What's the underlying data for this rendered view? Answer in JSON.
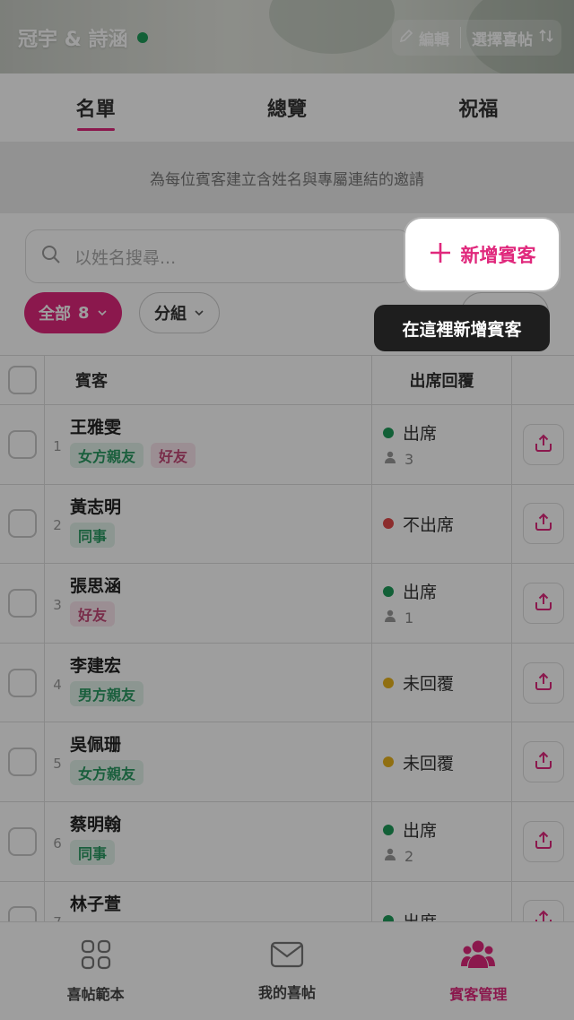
{
  "header": {
    "couple_name": "冠宇 & 詩涵",
    "edit_label": "編輯",
    "select_invite_label": "選擇喜帖"
  },
  "tabs": [
    {
      "label": "名單",
      "active": true
    },
    {
      "label": "總覽",
      "active": false
    },
    {
      "label": "祝福",
      "active": false
    }
  ],
  "info_text": "為每位賓客建立含姓名與專屬連結的邀請",
  "search": {
    "placeholder": "以姓名搜尋..."
  },
  "add_guest_label": "新增賓客",
  "tooltip_text": "在這裡新增賓客",
  "filters": {
    "all_label": "全部",
    "all_count": "8",
    "group_label": "分組"
  },
  "table": {
    "col_guest": "賓客",
    "col_rsvp": "出席回覆",
    "rows": [
      {
        "num": "1",
        "name": "王雅雯",
        "tags": [
          {
            "text": "女方親友",
            "color": "green"
          },
          {
            "text": "好友",
            "color": "pink"
          }
        ],
        "status": "出席",
        "status_color": "green",
        "count": "3"
      },
      {
        "num": "2",
        "name": "黃志明",
        "tags": [
          {
            "text": "同事",
            "color": "green"
          }
        ],
        "status": "不出席",
        "status_color": "red",
        "count": ""
      },
      {
        "num": "3",
        "name": "張思涵",
        "tags": [
          {
            "text": "好友",
            "color": "pink"
          }
        ],
        "status": "出席",
        "status_color": "green",
        "count": "1"
      },
      {
        "num": "4",
        "name": "李建宏",
        "tags": [
          {
            "text": "男方親友",
            "color": "green"
          }
        ],
        "status": "未回覆",
        "status_color": "yellow",
        "count": ""
      },
      {
        "num": "5",
        "name": "吳佩珊",
        "tags": [
          {
            "text": "女方親友",
            "color": "green"
          }
        ],
        "status": "未回覆",
        "status_color": "yellow",
        "count": ""
      },
      {
        "num": "6",
        "name": "蔡明翰",
        "tags": [
          {
            "text": "同事",
            "color": "green"
          }
        ],
        "status": "出席",
        "status_color": "green",
        "count": "2"
      },
      {
        "num": "7",
        "name": "林子萱",
        "tags": [],
        "status": "出席",
        "status_color": "green",
        "count": ""
      }
    ]
  },
  "bottom_nav": [
    {
      "label": "喜帖範本",
      "icon": "grid-icon",
      "active": false
    },
    {
      "label": "我的喜帖",
      "icon": "envelope-icon",
      "active": false
    },
    {
      "label": "賓客管理",
      "icon": "people-icon",
      "active": true
    }
  ],
  "colors": {
    "accent": "#e0287c",
    "attend": "#1e9c5a",
    "decline": "#e24a4a",
    "pending": "#e8b31c"
  }
}
